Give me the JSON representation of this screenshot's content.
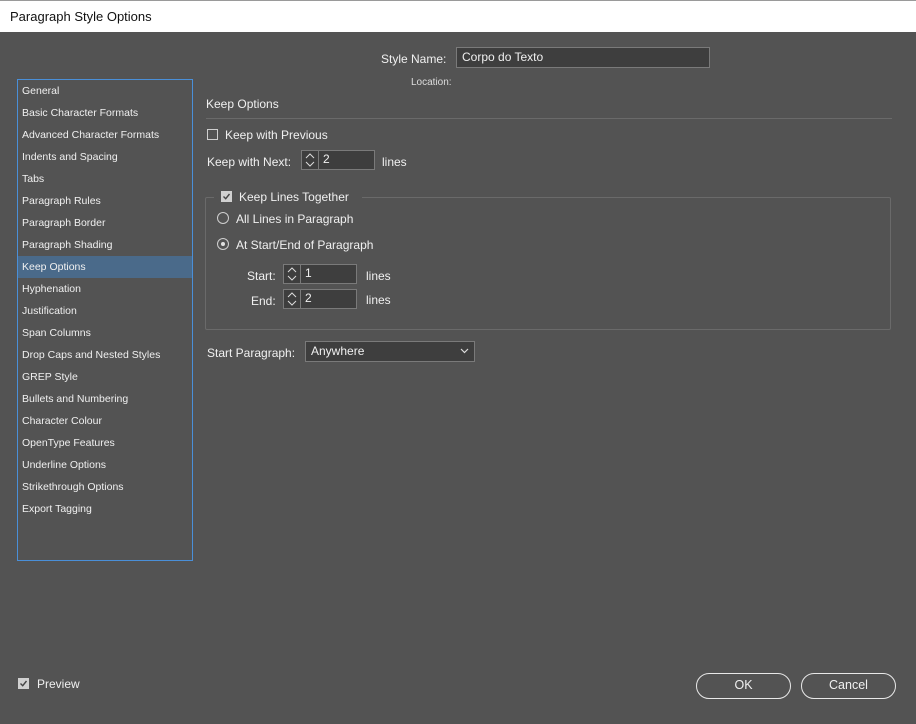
{
  "window": {
    "title": "Paragraph Style Options"
  },
  "sidebar": {
    "items": [
      {
        "label": "General"
      },
      {
        "label": "Basic Character Formats"
      },
      {
        "label": "Advanced Character Formats"
      },
      {
        "label": "Indents and Spacing"
      },
      {
        "label": "Tabs"
      },
      {
        "label": "Paragraph Rules"
      },
      {
        "label": "Paragraph Border"
      },
      {
        "label": "Paragraph Shading"
      },
      {
        "label": "Keep Options",
        "selected": true
      },
      {
        "label": "Hyphenation"
      },
      {
        "label": "Justification"
      },
      {
        "label": "Span Columns"
      },
      {
        "label": "Drop Caps and Nested Styles"
      },
      {
        "label": "GREP Style"
      },
      {
        "label": "Bullets and Numbering"
      },
      {
        "label": "Character Colour"
      },
      {
        "label": "OpenType Features"
      },
      {
        "label": "Underline Options"
      },
      {
        "label": "Strikethrough Options"
      },
      {
        "label": "Export Tagging"
      }
    ]
  },
  "header": {
    "style_name_label": "Style Name:",
    "style_name_value": "Corpo do Texto",
    "location_label": "Location:"
  },
  "section": {
    "title": "Keep Options"
  },
  "keep": {
    "keep_with_previous_label": "Keep with Previous",
    "keep_with_previous_checked": false,
    "keep_with_next_label": "Keep with Next:",
    "keep_with_next_value": "2",
    "lines_unit": "lines",
    "keep_lines_together_label": "Keep Lines Together",
    "keep_lines_together_checked": true,
    "all_lines_label": "All Lines in Paragraph",
    "at_start_end_label": "At Start/End of Paragraph",
    "selected_option": "At Start/End of Paragraph",
    "start_label": "Start:",
    "start_value": "1",
    "end_label": "End:",
    "end_value": "2",
    "start_paragraph_label": "Start Paragraph:",
    "start_paragraph_value": "Anywhere"
  },
  "footer": {
    "preview_label": "Preview",
    "preview_checked": true,
    "ok_label": "OK",
    "cancel_label": "Cancel"
  },
  "colors": {
    "background": "#535353",
    "selection": "#4a6a8a",
    "list_border": "#4a8fd8"
  }
}
